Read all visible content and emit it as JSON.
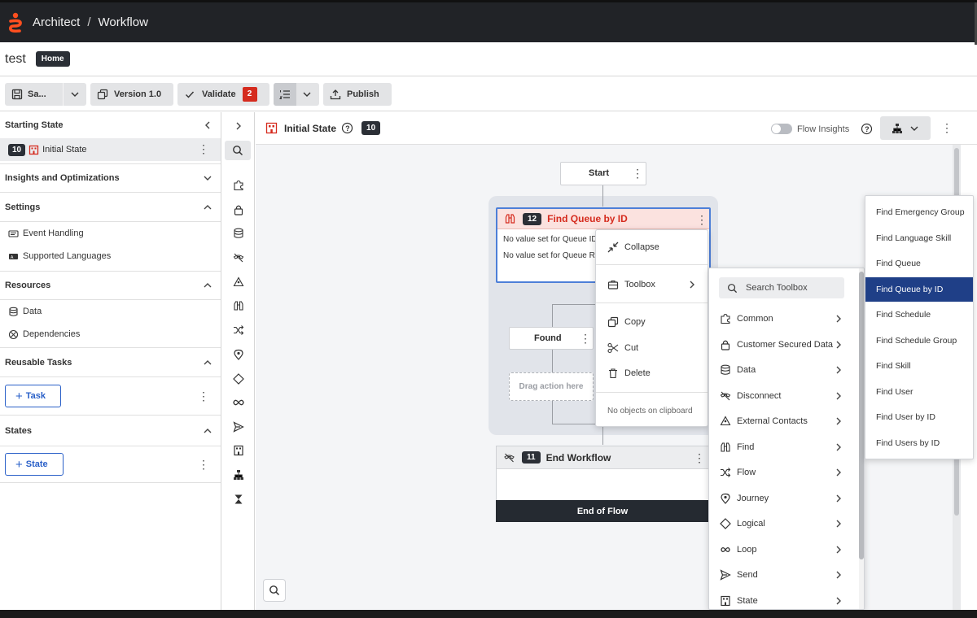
{
  "breadcrumb": {
    "app": "Architect",
    "separator": "/",
    "section": "Workflow"
  },
  "flow": {
    "name": "test",
    "home_badge": "Home"
  },
  "toolbar": {
    "save": "Sa...",
    "version": "Version 1.0",
    "validate": "Validate",
    "validate_count": "2",
    "publish": "Publish"
  },
  "left_panel": {
    "starting_state_header": "Starting State",
    "selected_state_num": "10",
    "selected_state_label": "Initial State",
    "insights_header": "Insights and Optimizations",
    "settings_header": "Settings",
    "settings_items": [
      "Event Handling",
      "Supported Languages"
    ],
    "resources_header": "Resources",
    "resources_items": [
      "Data",
      "Dependencies"
    ],
    "reusable_header": "Reusable Tasks",
    "task_button": "Task",
    "states_header": "States",
    "state_button": "State"
  },
  "canvas_header": {
    "title": "Initial State",
    "state_num": "10",
    "flow_insights": "Flow Insights"
  },
  "nodes": {
    "start": "Start",
    "find_num": "12",
    "find_title": "Find Queue by ID",
    "find_line1": "No value set for Queue ID",
    "find_line2": "No value set for Queue R",
    "found": "Found",
    "drag_hint": "Drag action here",
    "end_num": "11",
    "end_title": "End Workflow",
    "end_footer": "End of Flow"
  },
  "context_menu": {
    "collapse": "Collapse",
    "toolbox": "Toolbox",
    "copy": "Copy",
    "cut": "Cut",
    "delete": "Delete",
    "clipboard": "No objects on clipboard"
  },
  "toolbox_menu": {
    "search_placeholder": "Search Toolbox",
    "items": [
      "Common",
      "Customer Secured Data",
      "Data",
      "Disconnect",
      "External Contacts",
      "Find",
      "Flow",
      "Journey",
      "Logical",
      "Loop",
      "Send",
      "State"
    ]
  },
  "find_submenu": {
    "items": [
      "Find Emergency Group",
      "Find Language Skill",
      "Find Queue",
      "Find Queue by ID",
      "Find Schedule",
      "Find Schedule Group",
      "Find Skill",
      "Find User",
      "Find User by ID",
      "Find Users by ID"
    ],
    "selected": "Find Queue by ID"
  },
  "colors": {
    "accent_blue": "#2a60c8",
    "error_red": "#d52b1e",
    "selected_navy": "#1f3f87",
    "dark_bar": "#212327"
  }
}
